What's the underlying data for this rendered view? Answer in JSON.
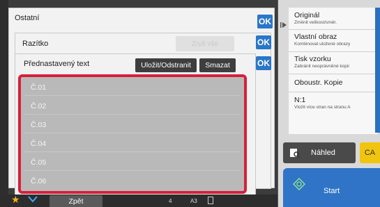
{
  "panels": {
    "ostatni": {
      "title": "Ostatní",
      "ok": "OK"
    },
    "razitko": {
      "title": "Razítko",
      "clear_all": "Zruš vše",
      "ok": "OK"
    },
    "text": {
      "title": "Přednastavený text",
      "save_edit": "Uložit/Odstranit",
      "delete": "Smazat",
      "ok": "OK",
      "items": [
        "Č.01",
        "Č.02",
        "Č.03",
        "Č.04",
        "Č.05",
        "Č.06"
      ]
    }
  },
  "right_menu": [
    {
      "title": "Originál",
      "subtitle": "Změnit velikost/směr."
    },
    {
      "title": "Vlastní obraz",
      "subtitle": "Kombinovat uložené obrazy"
    },
    {
      "title": "Tisk vzorku",
      "subtitle": "Zabránit neoprávněné kopii"
    },
    {
      "title": "Oboustr. Kopie",
      "subtitle": ""
    },
    {
      "title": "N:1",
      "subtitle": "Vložit více stran na stranu A"
    }
  ],
  "buttons": {
    "preview": "Náhled",
    "ca": "CA",
    "start": "Start"
  },
  "bottom_bar": {
    "back": "Zpět",
    "paper": "A3",
    "tray": "4"
  },
  "colors": {
    "accent": "#2a76c9",
    "highlight": "#d6203a",
    "ca": "#f1c40f"
  }
}
